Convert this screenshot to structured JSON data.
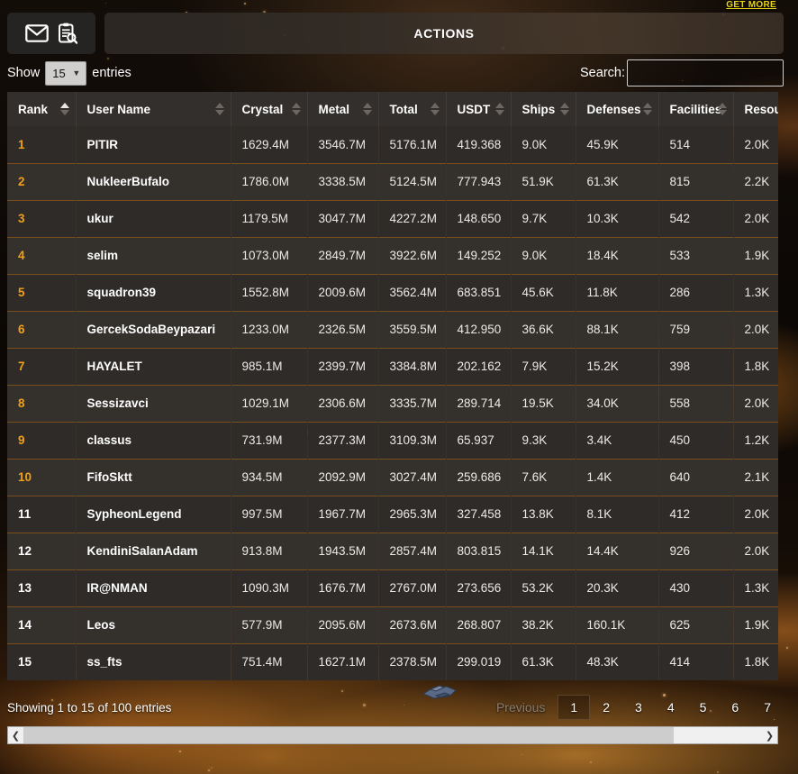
{
  "topbar": {
    "mail_icon": "envelope-icon",
    "report_icon": "clipboard-search-icon",
    "actions_label": "ACTIONS",
    "get_more_label": "GET MORE"
  },
  "controls": {
    "show_prefix": "Show",
    "show_value": "15",
    "show_options": [
      "15"
    ],
    "show_suffix": "entries",
    "search_label": "Search:",
    "search_value": "",
    "search_placeholder": ""
  },
  "table": {
    "columns": [
      {
        "label": "Rank",
        "sort": "asc"
      },
      {
        "label": "User Name",
        "sort": "none"
      },
      {
        "label": "Crystal",
        "sort": "none"
      },
      {
        "label": "Metal",
        "sort": "none"
      },
      {
        "label": "Total",
        "sort": "none"
      },
      {
        "label": "USDT",
        "sort": "none"
      },
      {
        "label": "Ships",
        "sort": "none"
      },
      {
        "label": "Defenses",
        "sort": "none"
      },
      {
        "label": "Facilities",
        "sort": "none"
      },
      {
        "label": "Resou",
        "sort": "none"
      }
    ],
    "rows": [
      {
        "rank": "1",
        "user": "PITIR",
        "crystal": "1629.4M",
        "metal": "3546.7M",
        "total": "5176.1M",
        "usdt": "419.368",
        "ships": "9.0K",
        "defenses": "45.9K",
        "facilities": "514",
        "resources": "2.0K"
      },
      {
        "rank": "2",
        "user": "NukleerBufalo",
        "crystal": "1786.0M",
        "metal": "3338.5M",
        "total": "5124.5M",
        "usdt": "777.943",
        "ships": "51.9K",
        "defenses": "61.3K",
        "facilities": "815",
        "resources": "2.2K"
      },
      {
        "rank": "3",
        "user": "ukur",
        "crystal": "1179.5M",
        "metal": "3047.7M",
        "total": "4227.2M",
        "usdt": "148.650",
        "ships": "9.7K",
        "defenses": "10.3K",
        "facilities": "542",
        "resources": "2.0K"
      },
      {
        "rank": "4",
        "user": "selim",
        "crystal": "1073.0M",
        "metal": "2849.7M",
        "total": "3922.6M",
        "usdt": "149.252",
        "ships": "9.0K",
        "defenses": "18.4K",
        "facilities": "533",
        "resources": "1.9K"
      },
      {
        "rank": "5",
        "user": "squadron39",
        "crystal": "1552.8M",
        "metal": "2009.6M",
        "total": "3562.4M",
        "usdt": "683.851",
        "ships": "45.6K",
        "defenses": "11.8K",
        "facilities": "286",
        "resources": "1.3K"
      },
      {
        "rank": "6",
        "user": "GercekSodaBeypazari",
        "crystal": "1233.0M",
        "metal": "2326.5M",
        "total": "3559.5M",
        "usdt": "412.950",
        "ships": "36.6K",
        "defenses": "88.1K",
        "facilities": "759",
        "resources": "2.0K"
      },
      {
        "rank": "7",
        "user": "HAYALET",
        "crystal": "985.1M",
        "metal": "2399.7M",
        "total": "3384.8M",
        "usdt": "202.162",
        "ships": "7.9K",
        "defenses": "15.2K",
        "facilities": "398",
        "resources": "1.8K"
      },
      {
        "rank": "8",
        "user": "Sessizavci",
        "crystal": "1029.1M",
        "metal": "2306.6M",
        "total": "3335.7M",
        "usdt": "289.714",
        "ships": "19.5K",
        "defenses": "34.0K",
        "facilities": "558",
        "resources": "2.0K"
      },
      {
        "rank": "9",
        "user": "classus",
        "crystal": "731.9M",
        "metal": "2377.3M",
        "total": "3109.3M",
        "usdt": "65.937",
        "ships": "9.3K",
        "defenses": "3.4K",
        "facilities": "450",
        "resources": "1.2K"
      },
      {
        "rank": "10",
        "user": "FifoSktt",
        "crystal": "934.5M",
        "metal": "2092.9M",
        "total": "3027.4M",
        "usdt": "259.686",
        "ships": "7.6K",
        "defenses": "1.4K",
        "facilities": "640",
        "resources": "2.1K"
      },
      {
        "rank": "11",
        "user": "SypheonLegend",
        "crystal": "997.5M",
        "metal": "1967.7M",
        "total": "2965.3M",
        "usdt": "327.458",
        "ships": "13.8K",
        "defenses": "8.1K",
        "facilities": "412",
        "resources": "2.0K"
      },
      {
        "rank": "12",
        "user": "KendiniSalanAdam",
        "crystal": "913.8M",
        "metal": "1943.5M",
        "total": "2857.4M",
        "usdt": "803.815",
        "ships": "14.1K",
        "defenses": "14.4K",
        "facilities": "926",
        "resources": "2.0K"
      },
      {
        "rank": "13",
        "user": "IR@NMAN",
        "crystal": "1090.3M",
        "metal": "1676.7M",
        "total": "2767.0M",
        "usdt": "273.656",
        "ships": "53.2K",
        "defenses": "20.3K",
        "facilities": "430",
        "resources": "1.3K"
      },
      {
        "rank": "14",
        "user": "Leos",
        "crystal": "577.9M",
        "metal": "2095.6M",
        "total": "2673.6M",
        "usdt": "268.807",
        "ships": "38.2K",
        "defenses": "160.1K",
        "facilities": "625",
        "resources": "1.9K"
      },
      {
        "rank": "15",
        "user": "ss_fts",
        "crystal": "751.4M",
        "metal": "1627.1M",
        "total": "2378.5M",
        "usdt": "299.019",
        "ships": "61.3K",
        "defenses": "48.3K",
        "facilities": "414",
        "resources": "1.8K"
      }
    ]
  },
  "footer": {
    "showing_text": "Showing 1 to 15 of 100 entries",
    "previous_label": "Previous",
    "pages": [
      "1",
      "2",
      "3",
      "4",
      "5",
      "6",
      "7"
    ],
    "active_page": "1"
  },
  "scrollbar": {
    "left_arrow": "chevron-left-icon",
    "right_arrow": "chevron-right-icon",
    "thumb_percent": 88
  },
  "colors": {
    "accent_orange": "#f0a018",
    "row_separator": "#7a4f1d",
    "get_more": "#e8d21a",
    "header_bg": "#332f2c"
  }
}
